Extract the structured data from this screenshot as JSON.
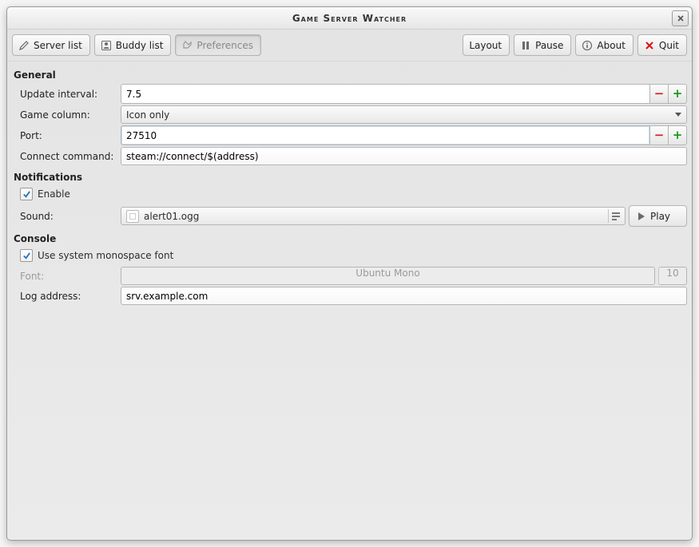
{
  "window": {
    "title": "Game Server Watcher"
  },
  "toolbar": {
    "server_list": "Server list",
    "buddy_list": "Buddy list",
    "preferences": "Preferences",
    "layout": "Layout",
    "pause": "Pause",
    "about": "About",
    "quit": "Quit"
  },
  "sections": {
    "general": {
      "header": "General"
    },
    "notifications": {
      "header": "Notifications"
    },
    "console": {
      "header": "Console"
    }
  },
  "general": {
    "update_interval_label": "Update interval:",
    "update_interval_value": "7.5",
    "game_column_label": "Game column:",
    "game_column_value": "Icon only",
    "port_label": "Port:",
    "port_value": "27510",
    "connect_cmd_label": "Connect command:",
    "connect_cmd_value": "steam://connect/$(address)"
  },
  "notifications": {
    "enable_label": "Enable",
    "enable_checked": true,
    "sound_label": "Sound:",
    "sound_file": "alert01.ogg",
    "play_label": "Play"
  },
  "console": {
    "use_monospace_label": "Use system monospace font",
    "use_monospace_checked": true,
    "font_label": "Font:",
    "font_name": "Ubuntu Mono",
    "font_size": "10",
    "log_addr_label": "Log address:",
    "log_addr_value": "srv.example.com"
  }
}
